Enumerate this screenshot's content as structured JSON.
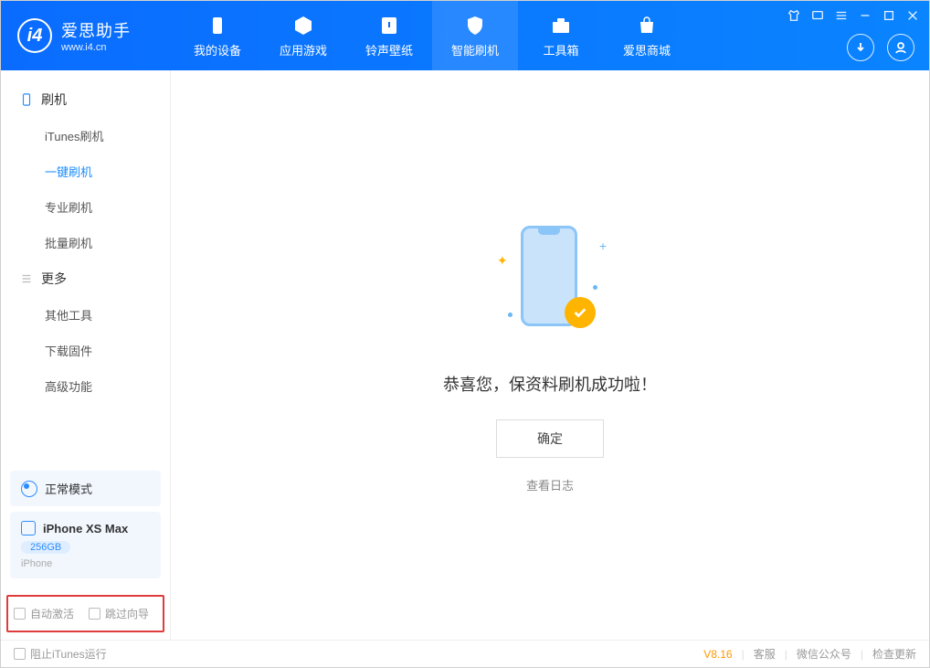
{
  "app": {
    "title": "爱思助手",
    "subtitle": "www.i4.cn"
  },
  "nav": {
    "items": [
      {
        "label": "我的设备"
      },
      {
        "label": "应用游戏"
      },
      {
        "label": "铃声壁纸"
      },
      {
        "label": "智能刷机"
      },
      {
        "label": "工具箱"
      },
      {
        "label": "爱思商城"
      }
    ]
  },
  "sidebar": {
    "group1": "刷机",
    "items1": [
      "iTunes刷机",
      "一键刷机",
      "专业刷机",
      "批量刷机"
    ],
    "group2": "更多",
    "items2": [
      "其他工具",
      "下载固件",
      "高级功能"
    ]
  },
  "mode": {
    "label": "正常模式"
  },
  "device": {
    "name": "iPhone XS Max",
    "capacity": "256GB",
    "type": "iPhone"
  },
  "options": {
    "auto_activate": "自动激活",
    "skip_guide": "跳过向导"
  },
  "main": {
    "success": "恭喜您，保资料刷机成功啦！",
    "ok": "确定",
    "view_log": "查看日志"
  },
  "footer": {
    "block_itunes": "阻止iTunes运行",
    "version": "V8.16",
    "support": "客服",
    "wechat": "微信公众号",
    "update": "检查更新"
  }
}
